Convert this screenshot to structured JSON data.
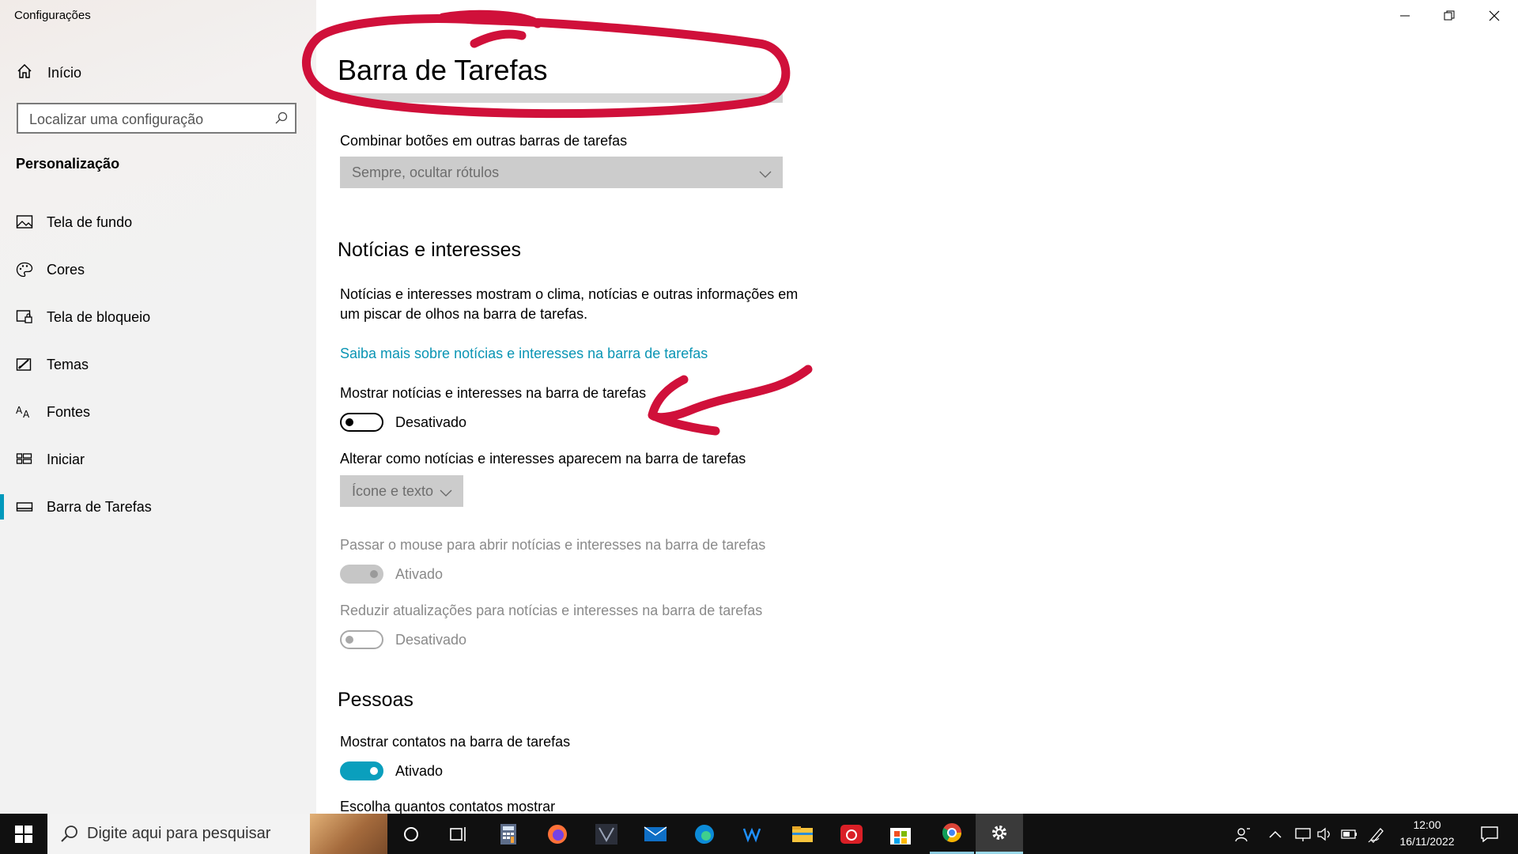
{
  "window": {
    "title": "Configurações",
    "controls": [
      "minimize-icon",
      "restore-icon",
      "close-icon"
    ]
  },
  "sidebar": {
    "home_label": "Início",
    "search_placeholder": "Localizar uma configuração",
    "section_title": "Personalização",
    "items": [
      {
        "label": "Tela de fundo",
        "icon": "picture-icon"
      },
      {
        "label": "Cores",
        "icon": "palette-icon"
      },
      {
        "label": "Tela de bloqueio",
        "icon": "lock-screen-icon"
      },
      {
        "label": "Temas",
        "icon": "themes-icon"
      },
      {
        "label": "Fontes",
        "icon": "fonts-icon"
      },
      {
        "label": "Iniciar",
        "icon": "start-icon"
      },
      {
        "label": "Barra de Tarefas",
        "icon": "taskbar-icon",
        "active": true
      }
    ]
  },
  "main": {
    "title": "Barra de Tarefas",
    "combine_label": "Combinar botões em outras barras de tarefas",
    "combine_value": "Sempre, ocultar rótulos",
    "news_heading": "Notícias e interesses",
    "news_description_line1": "Notícias e interesses mostram o clima, notícias e outras informações em",
    "news_description_line2": "um piscar de olhos na barra de tarefas.",
    "news_link": "Saiba mais sobre notícias e interesses na barra de tarefas",
    "show_news_label": "Mostrar notícias e interesses na barra de tarefas",
    "show_news_state": "Desativado",
    "show_news_on": false,
    "appearance_label": "Alterar como notícias e interesses aparecem na barra de tarefas",
    "appearance_value": "Ícone e texto",
    "hover_label": "Passar o mouse para abrir notícias e interesses na barra de tarefas",
    "hover_state": "Ativado",
    "hover_on": true,
    "reduce_label": "Reduzir atualizações para notícias e interesses na barra de tarefas",
    "reduce_state": "Desativado",
    "reduce_on": false,
    "people_heading": "Pessoas",
    "contacts_label": "Mostrar contatos na barra de tarefas",
    "contacts_state": "Ativado",
    "contacts_on": true,
    "contacts_count_label": "Escolha quantos contatos mostrar"
  },
  "colors": {
    "accent": "#0a9fbd",
    "link": "#0a95b4",
    "annotation": "#d0103a"
  },
  "taskbar": {
    "search_placeholder": "Digite aqui para pesquisar",
    "apps": [
      "cortana-icon",
      "task-view-icon",
      "calculator-icon",
      "firefox-icon",
      "predator-icon",
      "mail-icon",
      "edge-icon",
      "waves-icon",
      "file-explorer-icon",
      "creative-cloud-icon",
      "store-icon",
      "chrome-icon",
      "settings-icon"
    ],
    "tray": [
      "people-icon",
      "chevron-up-icon",
      "network-icon",
      "volume-icon",
      "battery-icon",
      "pen-icon"
    ],
    "time": "12:00",
    "date": "16/11/2022"
  }
}
